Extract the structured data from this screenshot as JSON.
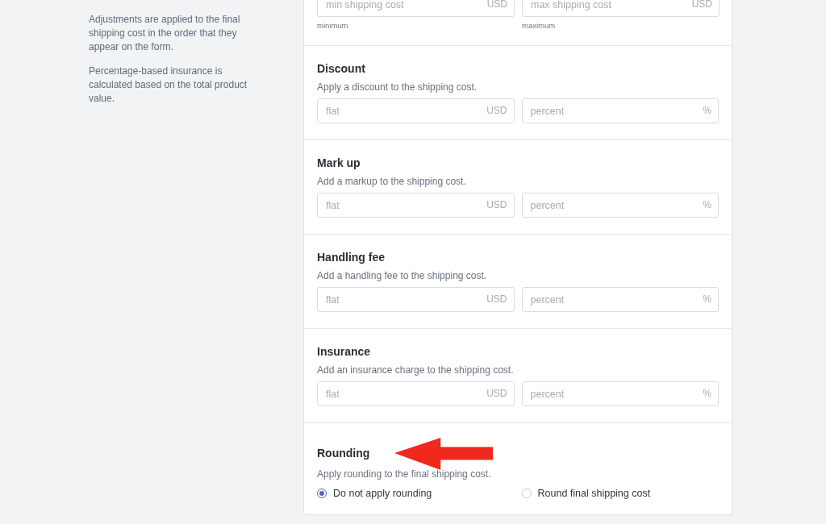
{
  "sidebar": {
    "paragraphs": [
      "Adjustments are applied to the final shipping cost in the order that they appear on the form.",
      "Percentage-based insurance is calculated based on the total product value."
    ]
  },
  "limits": {
    "fields": [
      {
        "placeholder": "min shipping cost",
        "unit": "USD",
        "hint": "minimum"
      },
      {
        "placeholder": "max shipping cost",
        "unit": "USD",
        "hint": "maximum"
      }
    ]
  },
  "sections": [
    {
      "title": "Discount",
      "description": "Apply a discount to the shipping cost.",
      "fields": [
        {
          "placeholder": "flat",
          "unit": "USD"
        },
        {
          "placeholder": "percent",
          "unit": "%"
        }
      ]
    },
    {
      "title": "Mark up",
      "description": "Add a markup to the shipping cost.",
      "fields": [
        {
          "placeholder": "flat",
          "unit": "USD"
        },
        {
          "placeholder": "percent",
          "unit": "%"
        }
      ]
    },
    {
      "title": "Handling fee",
      "description": "Add a handling fee to the shipping cost.",
      "fields": [
        {
          "placeholder": "flat",
          "unit": "USD"
        },
        {
          "placeholder": "percent",
          "unit": "%"
        }
      ]
    },
    {
      "title": "Insurance",
      "description": "Add an insurance charge to the shipping cost.",
      "fields": [
        {
          "placeholder": "flat",
          "unit": "USD"
        },
        {
          "placeholder": "percent",
          "unit": "%"
        }
      ]
    }
  ],
  "rounding": {
    "title": "Rounding",
    "description": "Apply rounding to the final shipping cost.",
    "options": [
      {
        "label": "Do not apply rounding",
        "selected": true
      },
      {
        "label": "Round final shipping cost",
        "selected": false
      }
    ]
  }
}
